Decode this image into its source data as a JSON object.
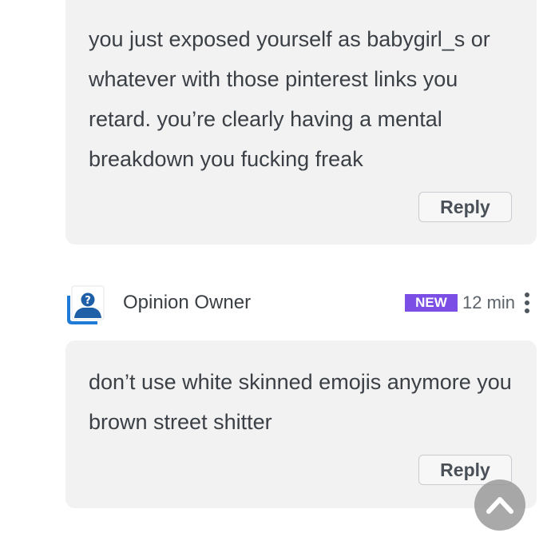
{
  "comments": [
    {
      "text": "you just exposed yourself as babygirl_s or whatever with those pinterest links you retard. you’re clearly having a mental breakdown you fucking freak",
      "reply_label": "Reply"
    },
    {
      "author": "Opinion Owner",
      "badge": "NEW",
      "timestamp": "12 min",
      "avatar_icon": "anonymous-user-icon",
      "text": "don’t use white skinned emojis anymore you brown street shitter",
      "reply_label": "Reply"
    }
  ],
  "icons": {
    "more": "more-vertical-icon",
    "scroll_top": "chevron-up-icon"
  },
  "colors": {
    "card_bg": "#f2f2f2",
    "badge_bg": "#7b4ee6",
    "avatar_blue": "#1e7bd6",
    "text": "#3b4046"
  }
}
